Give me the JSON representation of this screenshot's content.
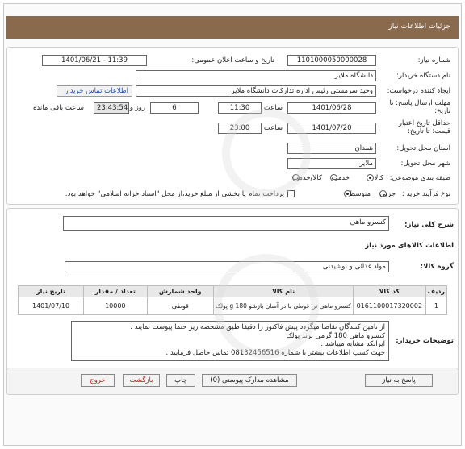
{
  "header": {
    "title": "جزئیات اطلاعات نیاز"
  },
  "form": {
    "need_number_label": "شماره نیاز:",
    "need_number": "1101000050000028",
    "announce_label": "تاریخ و ساعت اعلان عمومی:",
    "announce_value": "1401/06/21 - 11:39",
    "buyer_label": "نام دستگاه خریدار:",
    "buyer_value": "دانشگاه ملایر",
    "creator_label": "ایجاد کننده درخواست:",
    "creator_value": "وحید سرمستی رئیس اداره تدارکات دانشگاه ملایر",
    "contact_button": "اطلاعات تماس خریدار",
    "deadline_label_1": "مهلت ارسال پاسخ: تا",
    "deadline_label_2": "تاریخ:",
    "deadline_date": "1401/06/28",
    "time_label": "ساعت",
    "deadline_time": "11:30",
    "days_value": "6",
    "days_label": "روز و",
    "remaining_time": "23:43:54",
    "remaining_label": "ساعت باقی مانده",
    "validity_label_1": "حداقل تاریخ اعتبار",
    "validity_label_2": "قیمت: تا تاریخ:",
    "validity_date": "1401/07/20",
    "validity_time": "23:00",
    "province_label": "استان محل تحویل:",
    "province_value": "همدان",
    "city_label": "شهر محل تحویل:",
    "city_value": "ملایر",
    "category_label": "طبقه بندی موضوعی:",
    "category_options": [
      "کالا",
      "خدمت",
      "کالا/خدمت"
    ],
    "process_label": "نوع فرآیند خرید :",
    "process_options": [
      "جزیی",
      "متوسط"
    ],
    "payment_note": "پرداخت تمام یا بخشی از مبلغ خرید،از محل \"اسناد خزانه اسلامی\" خواهد بود."
  },
  "need": {
    "summary_label": "شرح کلی نیاز:",
    "summary_value": "کنسرو ماهی",
    "goods_info_title": "اطلاعات کالاهای مورد نیاز",
    "group_label": "گروه کالا:",
    "group_value": "مواد غذائی و نوشیدنی"
  },
  "table": {
    "headers": [
      "ردیف",
      "کد کالا",
      "نام کالا",
      "واحد شمارش",
      "تعداد / مقدار",
      "تاریخ نیاز"
    ],
    "rows": [
      [
        "1",
        "0161100017320002",
        "کنسرو ماهی تن قوطی با در آسان بازشو 180 g پولک",
        "قوطی",
        "10000",
        "1401/07/10"
      ]
    ]
  },
  "buyer_notes": {
    "label": "توضیحات خریدار:",
    "lines": [
      "از تامین کنندگان تقاضا میگردد پیش فاکتور را دقیقا طبق مشخصه زیر حتما پیوست نمایند .",
      "کنسرو ماهی 180 گرمی برند پولک",
      "ایرانکد مشابه میباشد .",
      "جهت کسب اطلاعات بیشتر با شماره  08132456516 تماس حاصل فرمایید ."
    ]
  },
  "actions": {
    "reply": "پاسخ به نیاز",
    "attachments": "مشاهده مدارک پیوستی (0)",
    "print": "چاپ",
    "back": "بازگشت",
    "exit": "خروج"
  },
  "colors": {
    "header_bg": "#8a6a4d",
    "link": "#1a4fb0",
    "exit": "#c41a1a"
  }
}
